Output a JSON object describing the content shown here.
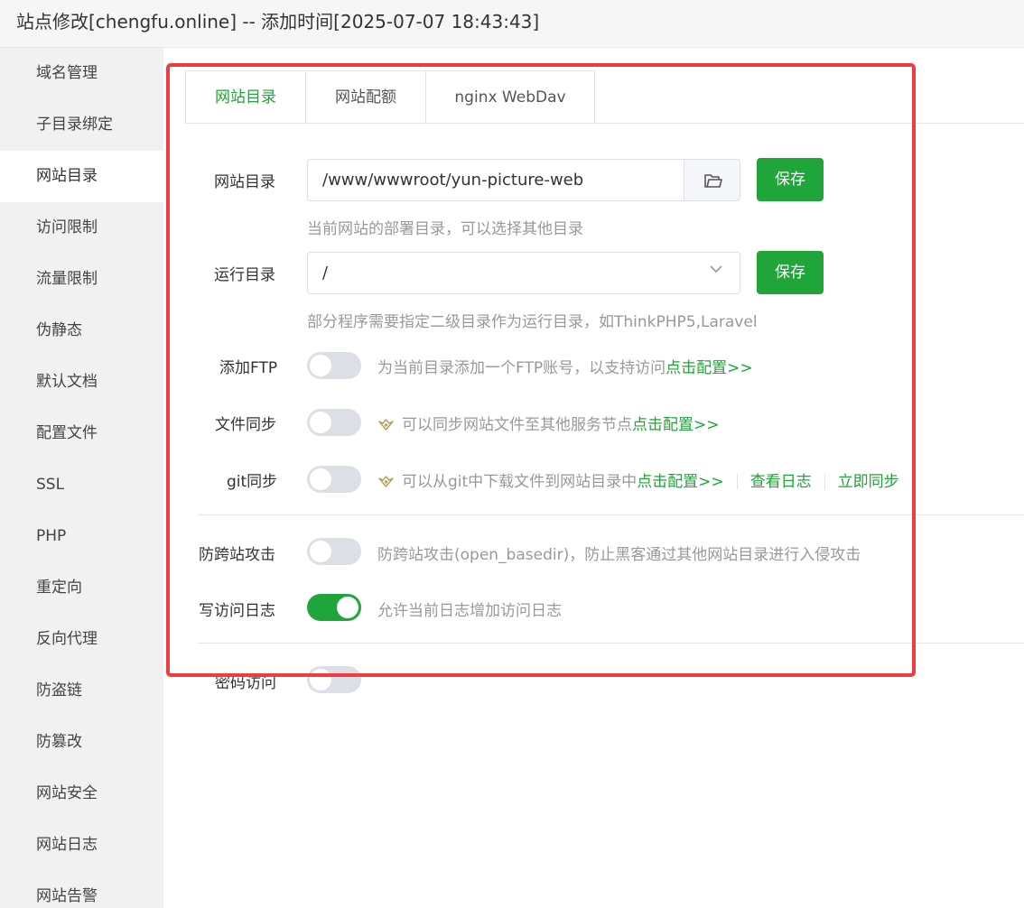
{
  "window": {
    "title": "站点修改[chengfu.online] -- 添加时间[2025-07-07 18:43:43]"
  },
  "sidebar": {
    "items": [
      {
        "label": "域名管理"
      },
      {
        "label": "子目录绑定"
      },
      {
        "label": "网站目录"
      },
      {
        "label": "访问限制"
      },
      {
        "label": "流量限制"
      },
      {
        "label": "伪静态"
      },
      {
        "label": "默认文档"
      },
      {
        "label": "配置文件"
      },
      {
        "label": "SSL"
      },
      {
        "label": "PHP"
      },
      {
        "label": "重定向"
      },
      {
        "label": "反向代理"
      },
      {
        "label": "防盗链"
      },
      {
        "label": "防篡改"
      },
      {
        "label": "网站安全"
      },
      {
        "label": "网站日志"
      },
      {
        "label": "网站告警"
      }
    ],
    "active": "网站目录"
  },
  "tabs": [
    {
      "label": "网站目录",
      "active": true
    },
    {
      "label": "网站配额",
      "active": false
    },
    {
      "label": "nginx WebDav",
      "active": false
    }
  ],
  "form": {
    "site_dir": {
      "label": "网站目录",
      "value": "/www/wwwroot/yun-picture-web",
      "save_label": "保存",
      "hint": "当前网站的部署目录，可以选择其他目录"
    },
    "run_dir": {
      "label": "运行目录",
      "value": "/",
      "save_label": "保存",
      "hint": "部分程序需要指定二级目录作为运行目录，如ThinkPHP5,Laravel"
    },
    "ftp": {
      "label": "添加FTP",
      "enabled": false,
      "desc": "为当前目录添加一个FTP账号，以支持访问",
      "link": "点击配置>>"
    },
    "file_sync": {
      "label": "文件同步",
      "enabled": false,
      "desc": "可以同步网站文件至其他服务节点",
      "link": "点击配置>>"
    },
    "git_sync": {
      "label": "git同步",
      "enabled": false,
      "desc": "可以从git中下载文件到网站目录中",
      "link": "点击配置>>",
      "view_log": "查看日志",
      "sync_now": "立即同步"
    },
    "anti_cross": {
      "label": "防跨站攻击",
      "enabled": false,
      "desc": "防跨站攻击(open_basedir)，防止黑客通过其他网站目录进行入侵攻击"
    },
    "access_log": {
      "label": "写访问日志",
      "enabled": true,
      "desc": "允许当前日志增加访问日志"
    },
    "password_access": {
      "label": "密码访问",
      "enabled": false
    }
  },
  "colors": {
    "accent": "#20a53a",
    "highlight": "#ef3d3d",
    "crown": "#b89a5a"
  }
}
